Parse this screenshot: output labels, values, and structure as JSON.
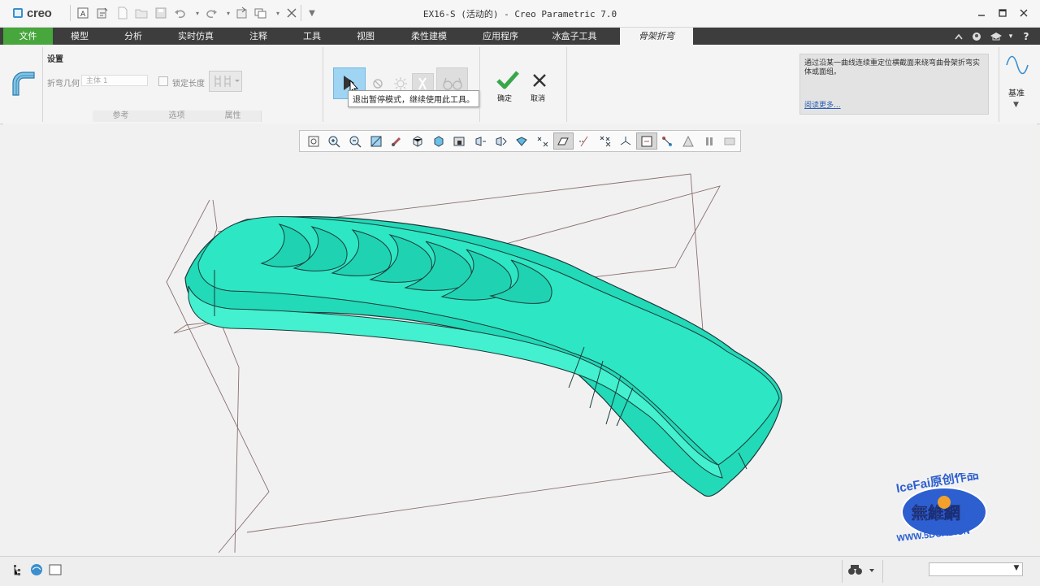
{
  "app": {
    "logo_text": "creo",
    "window_title": "EX16-S (活动的) - Creo Parametric 7.0"
  },
  "tabs": [
    {
      "label": "文件"
    },
    {
      "label": "模型"
    },
    {
      "label": "分析"
    },
    {
      "label": "实时仿真"
    },
    {
      "label": "注释"
    },
    {
      "label": "工具"
    },
    {
      "label": "视图"
    },
    {
      "label": "柔性建模"
    },
    {
      "label": "应用程序"
    },
    {
      "label": "冰盒子工具"
    },
    {
      "label": "骨架折弯"
    }
  ],
  "ribbon": {
    "settings_label": "设置",
    "bend_geometry_label": "折弯几何",
    "bend_geometry_value": "主体 1",
    "lock_length_label": "锁定长度",
    "panel_tabs": [
      "参考",
      "选项",
      "属性"
    ],
    "ok_label": "确定",
    "cancel_label": "取消",
    "tooltip": "退出暂停模式，继续使用此工具。",
    "help_text": "通过沿某一曲线连续重定位横截面来绕弯曲骨架折弯实体或面组。",
    "help_link": "阅读更多...",
    "datum_label": "基准"
  },
  "watermark": {
    "line1": "IceFai原创作品",
    "line2": "無維網",
    "line3": "WWW.5DCAD.CN"
  },
  "colors": {
    "file_tab": "#47a63c",
    "tab_bar": "#3d3d3d",
    "model_fill": "#2ce5c2",
    "ok_check": "#3aa64b",
    "pause_button": "#9fd4f2"
  }
}
